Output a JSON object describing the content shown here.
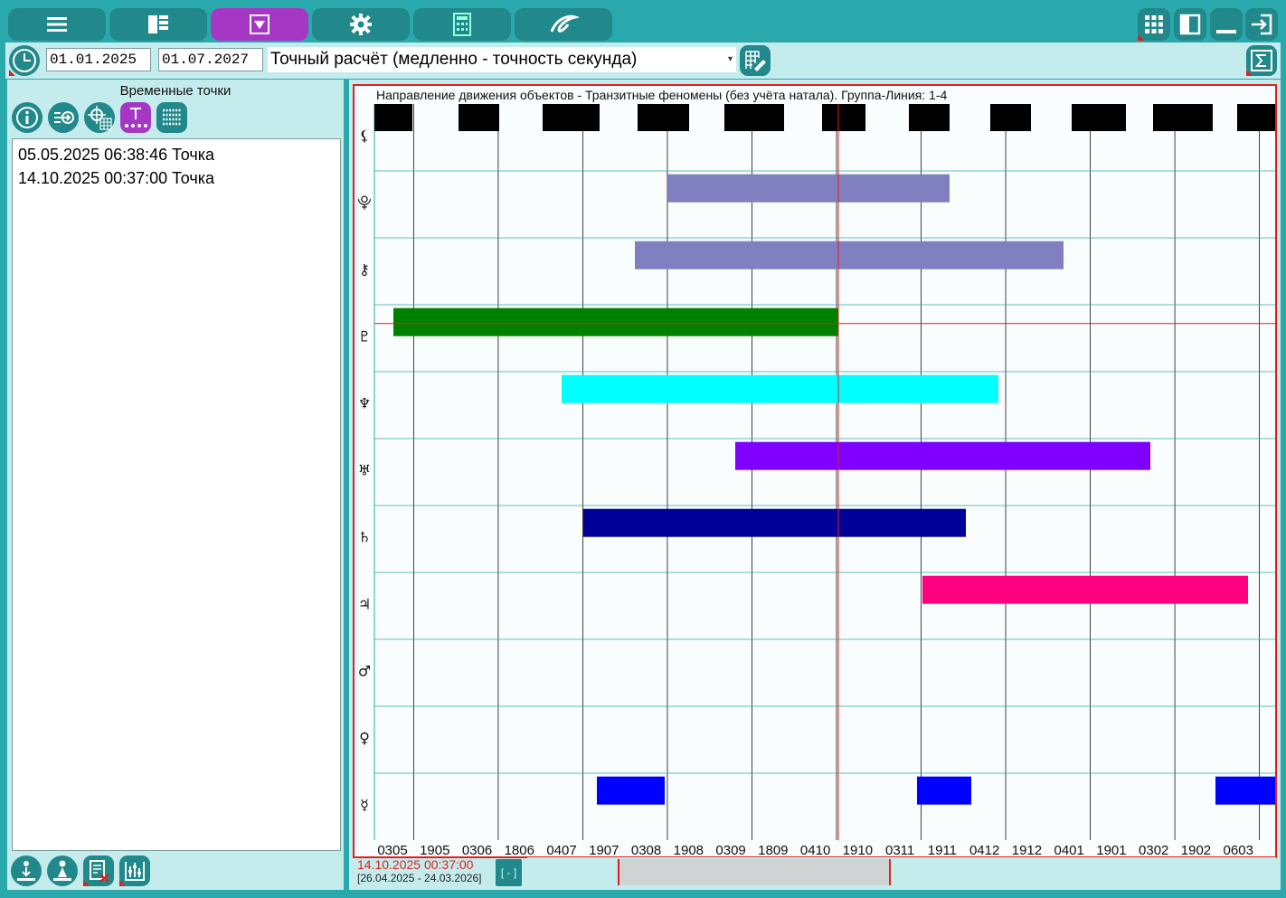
{
  "top_tabs": [
    {
      "name": "menu-tab",
      "icon": "menu-icon",
      "active": false
    },
    {
      "name": "layout-tab",
      "icon": "layout-icon",
      "active": false
    },
    {
      "name": "dropdown-tab",
      "icon": "dropdown-box-icon",
      "active": true
    },
    {
      "name": "settings-tab",
      "icon": "gear-icon",
      "active": false
    },
    {
      "name": "calculator-tab",
      "icon": "calculator-icon",
      "active": false
    },
    {
      "name": "logo-tab",
      "icon": "logo-icon",
      "active": false
    }
  ],
  "window_buttons": [
    "grid-icon",
    "panel-toggle-icon",
    "minimize-icon",
    "exit-icon"
  ],
  "toolbar": {
    "date_from": "01.01.2025",
    "date_to": "01.07.2027",
    "mode_select": "Точный расчёт (медленно - точность секунда)"
  },
  "left_panel": {
    "title": "Временные точки",
    "tool_icons": [
      "info-icon",
      "import-icon",
      "target-grid-icon",
      "timeline-point-icon",
      "list-icon"
    ],
    "items": [
      "05.05.2025 06:38:46 Точка",
      "14.10.2025 00:37:00 Точка"
    ],
    "bottom_icons": [
      "person-down-icon",
      "person-icon",
      "delete-list-icon",
      "chart-adjust-icon"
    ]
  },
  "colors": {
    "frame": "#2aa9ad",
    "panel": "#c5ecec",
    "button": "#21888b",
    "active": "#a637c5",
    "cursor": "#e02020"
  },
  "status": {
    "current_date": "14.10.2025 00:37:00",
    "range": "[26.04.2025 - 24.03.2026]",
    "zoom_label": "[ - ]"
  },
  "chart_data": {
    "type": "gantt",
    "title": "Направление движения объектов - Транзитные феномены (без учёта натала). Группа-Линия: 1-4",
    "x_range": [
      "2025-04-26",
      "2026-03-24"
    ],
    "x_tick_labels": [
      "0305",
      "1905",
      "0306",
      "1806",
      "0407",
      "1907",
      "0308",
      "1908",
      "0309",
      "1809",
      "0410",
      "1910",
      "0311",
      "1911",
      "0412",
      "1912",
      "0401",
      "1901",
      "0302",
      "1902",
      "0603"
    ],
    "cursor_date": "2025-10-14",
    "rows": [
      {
        "symbol": "⚸",
        "name": "Лилит",
        "color": "#000000",
        "bars": [
          [
            "2025-04-26",
            "2025-05-10"
          ],
          [
            "2025-05-27",
            "2025-06-11"
          ],
          [
            "2025-06-27",
            "2025-07-18"
          ],
          [
            "2025-08-01",
            "2025-08-20"
          ],
          [
            "2025-09-02",
            "2025-09-24"
          ],
          [
            "2025-10-08",
            "2025-10-24"
          ],
          [
            "2025-11-09",
            "2025-11-24"
          ],
          [
            "2025-12-09",
            "2025-12-24"
          ],
          [
            "2026-01-08",
            "2026-01-28"
          ],
          [
            "2026-02-07",
            "2026-03-01"
          ],
          [
            "2026-03-10",
            "2026-03-24"
          ]
        ]
      },
      {
        "symbol": "⯓",
        "name": "Плутон (альт.)",
        "color": "#8080c0",
        "bars": [
          [
            "2025-08-12",
            "2025-11-24"
          ]
        ]
      },
      {
        "symbol": "⚷",
        "name": "Хирон",
        "color": "#8080c0",
        "bars": [
          [
            "2025-07-31",
            "2026-01-05"
          ]
        ]
      },
      {
        "symbol": "♇",
        "name": "Плутон",
        "color": "#008000",
        "bars": [
          [
            "2025-05-03",
            "2025-10-14"
          ]
        ]
      },
      {
        "symbol": "♆",
        "name": "Нептун",
        "color": "#00ffff",
        "bars": [
          [
            "2025-07-04",
            "2025-12-12"
          ]
        ]
      },
      {
        "symbol": "♅",
        "name": "Уран",
        "color": "#8000ff",
        "bars": [
          [
            "2025-09-06",
            "2026-02-06"
          ]
        ]
      },
      {
        "symbol": "♄",
        "name": "Сатурн",
        "color": "#000099",
        "bars": [
          [
            "2025-07-12",
            "2025-11-30"
          ]
        ]
      },
      {
        "symbol": "♃",
        "name": "Юпитер",
        "color": "#ff0080",
        "bars": [
          [
            "2025-11-14",
            "2026-03-14"
          ]
        ]
      },
      {
        "symbol": "♂",
        "name": "Марс",
        "color": "#000000",
        "bars": []
      },
      {
        "symbol": "♀",
        "name": "Венера",
        "color": "#000000",
        "bars": []
      },
      {
        "symbol": "☿",
        "name": "Меркурий",
        "color": "#0000ff",
        "bars": [
          [
            "2025-07-17",
            "2025-08-11"
          ],
          [
            "2025-11-12",
            "2025-12-02"
          ],
          [
            "2026-03-02",
            "2026-03-24"
          ]
        ]
      }
    ]
  }
}
